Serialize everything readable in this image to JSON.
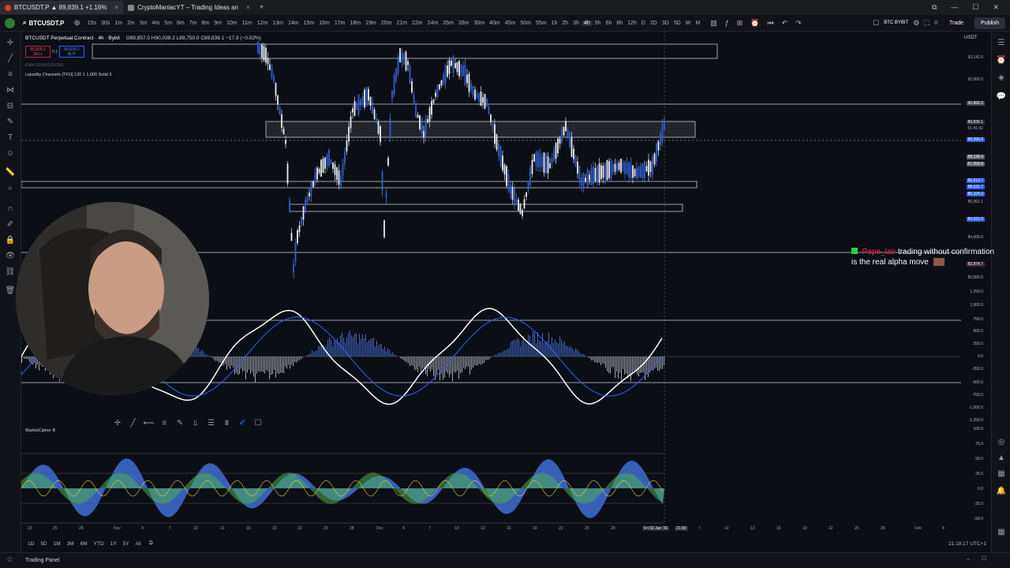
{
  "browser": {
    "tab1": "BTCUSDT.P ▲ 89,839.1 +1.16%",
    "tab2": "CryptoManiacYT – Trading Ideas an",
    "close": "×",
    "new_tab": "+"
  },
  "toolbar": {
    "symbol": "BTCUSDT.P",
    "timeframes": [
      "15s",
      "30s",
      "1m",
      "2m",
      "3m",
      "4m",
      "5m",
      "6m",
      "7m",
      "8m",
      "9m",
      "10m",
      "11m",
      "12m",
      "13m",
      "14m",
      "15m",
      "16m",
      "17m",
      "18m",
      "19m",
      "20m",
      "21m",
      "22m",
      "24m",
      "26m",
      "28m",
      "30m",
      "40m",
      "45m",
      "50m",
      "55m",
      "1h",
      "2h",
      "3h",
      "4h",
      "5h",
      "6h",
      "8h",
      "12h",
      "D",
      "2D",
      "3D",
      "5D",
      "W",
      "M"
    ],
    "selected_timeframe": "4h",
    "exchange_label": "BTC BYBIT",
    "trade_label": "Trade",
    "publish_label": "Publish"
  },
  "legend": {
    "title": "BTCUSDT Perpetual Contract · 4h · Bybit",
    "ohlc": "O89,857.0 H90,038.2 L89,750.0 C89,839.1 −17.9 (−0.02%)",
    "sell_price": "89,839.1",
    "sell_label": "SELL",
    "spread": "0.1",
    "buy_price": "89,839.2",
    "buy_label": "BUY",
    "ema_line": "EMA 20/50/100/200",
    "indicator2": "Liquidity Channels [TFO] 120 1 1,000 Solid 3",
    "marketcipher": "MarketCipher B"
  },
  "price_scale": {
    "currency": "USDT",
    "labels": [
      "93,142.5",
      "92,000.0",
      "90,860.3",
      "89,839.1",
      "01:41:42",
      "89,390.6",
      "88,138.4",
      "87,958.8",
      "86,919.7",
      "86,611.7",
      "86,329.3",
      "85,961.1",
      "84,915.9",
      "84,000.0",
      "82,874.7",
      "82,000.0"
    ],
    "osc_labels": [
      "1,250.0",
      "1,000.0",
      "750.0",
      "500.0",
      "250.0",
      "0.0",
      "-250.0",
      "-500.0",
      "-750.0",
      "-1,000.0",
      "-1,250.0"
    ],
    "mc_labels": [
      "100.0",
      "75.0",
      "50.0",
      "25.0",
      "0.0",
      "-25.0",
      "-50.0"
    ]
  },
  "x_axis": {
    "labels": [
      "22",
      "25",
      "28",
      "Nov",
      "4",
      "7",
      "10",
      "13",
      "16",
      "19",
      "22",
      "25",
      "28",
      "Dec",
      "4",
      "7",
      "10",
      "13",
      "16",
      "19",
      "22",
      "25",
      "28",
      "Fri 02 Jan '26",
      "21:00",
      "7",
      "10",
      "13",
      "16",
      "19",
      "22",
      "25",
      "28",
      "Feb",
      "4"
    ]
  },
  "bottom": {
    "ranges": [
      "1D",
      "5D",
      "1M",
      "3M",
      "6M",
      "YTD",
      "1Y",
      "5Y",
      "All"
    ],
    "clock": "21:18:17 UTC+1",
    "trading_panel": "Trading Panel"
  },
  "chat": {
    "user": "Pepe_lair",
    "message_line1": "trading without confirmation",
    "message_line2": "is the real alpha move"
  },
  "colors": {
    "background": "#0c0e15",
    "candles": "#4d7ee8",
    "accent_blue": "#2962ff",
    "sell_red": "#b2283a",
    "buy_blue": "#2962ff"
  }
}
